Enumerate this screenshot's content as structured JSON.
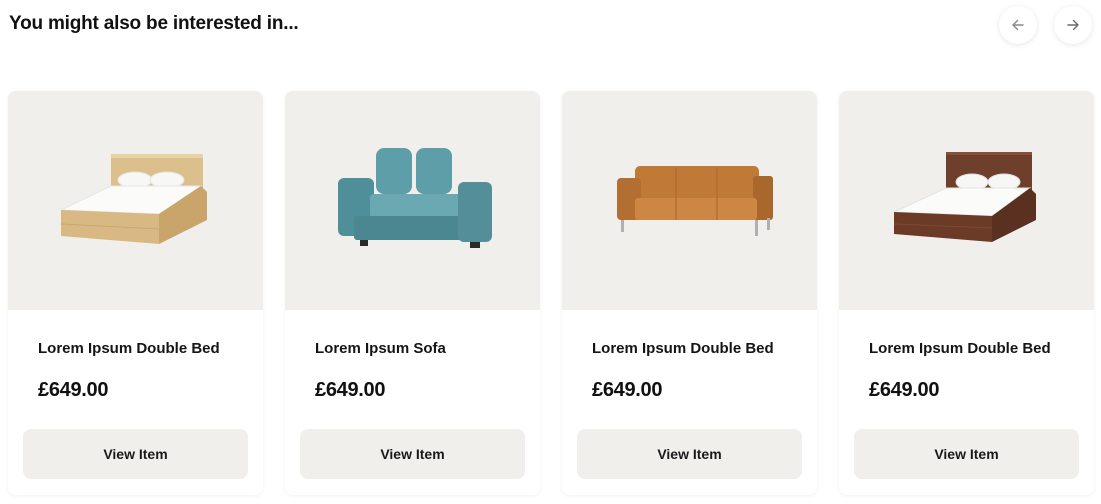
{
  "section": {
    "title": "You might also be interested in..."
  },
  "nav": {
    "prev_icon": "arrow-left-icon",
    "next_icon": "arrow-right-icon"
  },
  "products": [
    {
      "name": "Lorem Ipsum Double Bed",
      "price": "£649.00",
      "button_label": "View Item",
      "image": "light-oak-double-bed-image"
    },
    {
      "name": "Lorem Ipsum Sofa",
      "price": "£649.00",
      "button_label": "View Item",
      "image": "teal-two-seat-sofa-image"
    },
    {
      "name": "Lorem Ipsum Double Bed",
      "price": "£649.00",
      "button_label": "View Item",
      "image": "tan-leather-sofa-image"
    },
    {
      "name": "Lorem Ipsum Double Bed",
      "price": "£649.00",
      "button_label": "View Item",
      "image": "dark-wood-double-bed-image"
    }
  ],
  "colors": {
    "image_bg": "#f0efec",
    "button_bg": "#f0efec",
    "text": "#111111"
  }
}
